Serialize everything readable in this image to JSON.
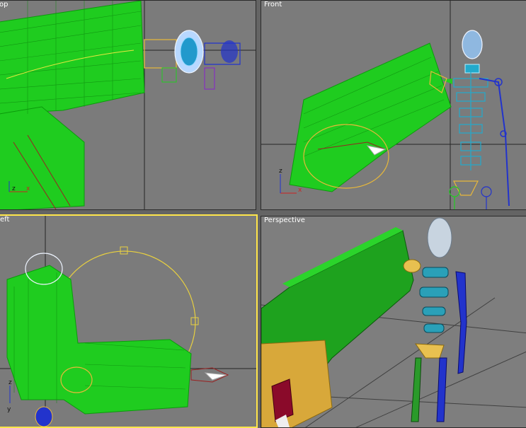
{
  "viewports": {
    "top": {
      "label": "op"
    },
    "front": {
      "label": "Front"
    },
    "left": {
      "label": "eft"
    },
    "perspective": {
      "label": "Perspective"
    }
  },
  "axis_labels": {
    "x": "x",
    "z": "z",
    "y": "y"
  },
  "colors": {
    "viewport_bg": "#7b7b7b",
    "active_border": "#ffe64a",
    "grid": "#262626",
    "mesh_green": "#22cc22",
    "bone_yellow": "#e8b83a",
    "skull_white": "#e0e8f8",
    "spine_cyan": "#22aacc",
    "arm_blue": "#2233cc"
  }
}
